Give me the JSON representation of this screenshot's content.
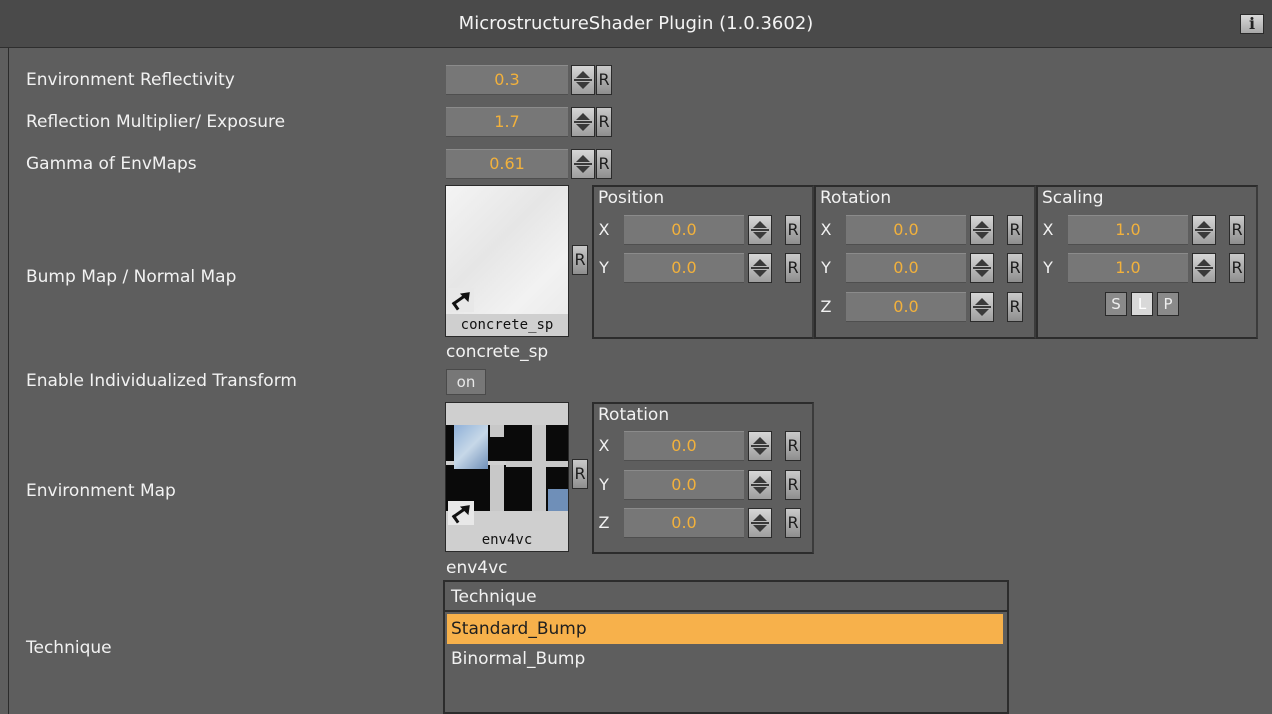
{
  "window": {
    "title": "MicrostructureShader Plugin (1.0.3602)",
    "info_label": "i"
  },
  "params": {
    "env_reflectivity": {
      "label": "Environment Reflectivity",
      "value": "0.3"
    },
    "reflection_multiplier": {
      "label": "Reflection Multiplier/ Exposure",
      "value": "1.7"
    },
    "gamma_envmaps": {
      "label": "Gamma of EnvMaps",
      "value": "0.61"
    },
    "reset_label": "R"
  },
  "bump_map": {
    "label": "Bump Map / Normal Map",
    "texture_name": "concrete_sp",
    "caption": "concrete_sp",
    "position": {
      "title": "Position",
      "x_label": "X",
      "x": "0.0",
      "y_label": "Y",
      "y": "0.0"
    },
    "rotation": {
      "title": "Rotation",
      "x_label": "X",
      "x": "0.0",
      "y_label": "Y",
      "y": "0.0",
      "z_label": "Z",
      "z": "0.0"
    },
    "scaling": {
      "title": "Scaling",
      "x_label": "X",
      "x": "1.0",
      "y_label": "Y",
      "y": "1.0",
      "s": "S",
      "l": "L",
      "p": "P"
    }
  },
  "individual_transform": {
    "label": "Enable Individualized Transform",
    "state": "on"
  },
  "env_map": {
    "label": "Environment Map",
    "texture_name": "env4vc",
    "caption": "env4vc",
    "rotation": {
      "title": "Rotation",
      "x_label": "X",
      "x": "0.0",
      "y_label": "Y",
      "y": "0.0",
      "z_label": "Z",
      "z": "0.0"
    }
  },
  "technique": {
    "label": "Technique",
    "header": "Technique",
    "options": [
      "Standard_Bump",
      "Binormal_Bump"
    ],
    "selected": "Standard_Bump"
  },
  "colors": {
    "background": "#5e5e5e",
    "value_text": "#f2b13c",
    "selection": "#f7b14b"
  },
  "icons": {
    "info": "info-icon",
    "spinner": "spinner-arrows-icon",
    "shortcut": "shortcut-arrow-icon"
  }
}
